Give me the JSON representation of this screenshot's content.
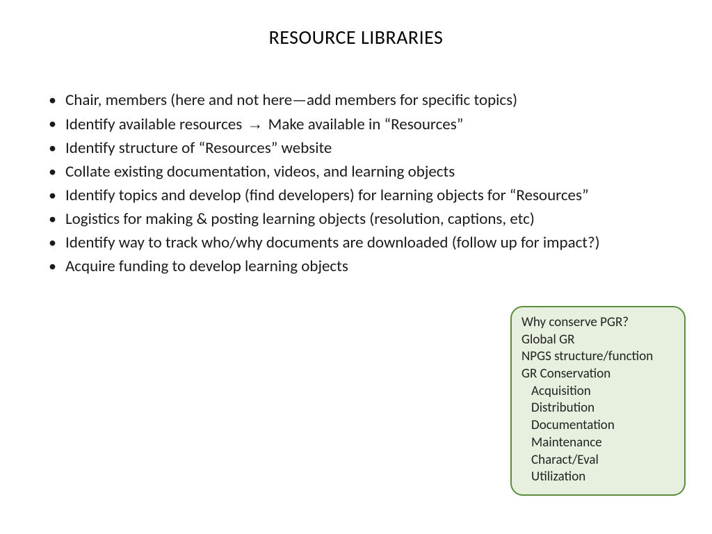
{
  "title": "RESOURCE LIBRARIES",
  "bullets": [
    "Chair, members (here and not here—add members for specific topics)",
    "Identify available resources → Make available in “Resources”",
    "Identify structure of “Resources” website",
    "Collate existing documentation, videos, and learning objects",
    "Identify topics and develop (find developers) for learning objects for “Resources”",
    "Logistics for making & posting learning objects (resolution, captions, etc)",
    "Identify way to track who/why documents are downloaded (follow up for impact?)",
    "Acquire funding to develop learning objects"
  ],
  "bullet1_pre": "Identify available resources ",
  "bullet1_arrow": "→",
  "bullet1_post": " Make available in “Resources”",
  "callout": {
    "line0": "Why conserve PGR?",
    "line1": "Global GR",
    "line2": "NPGS structure/function",
    "line3": "GR Conservation",
    "sub0": "Acquisition",
    "sub1": "Distribution",
    "sub2": "Documentation",
    "sub3": "Maintenance",
    "sub4": "Charact/Eval",
    "sub5": "Utilization"
  }
}
